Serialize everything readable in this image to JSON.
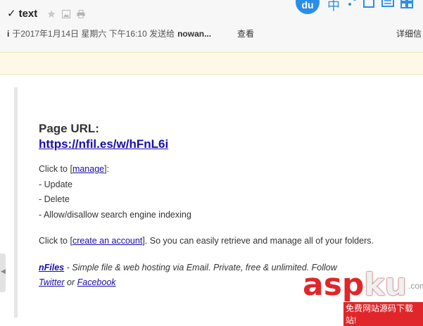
{
  "header": {
    "check_mark": "✓",
    "subject": "text",
    "meta_icon": "i",
    "meta_text": "于2017年1月14日 星期六 下午16:10 发送给",
    "recipient": "nowan...",
    "view_label": "查看",
    "details_label": "详细信"
  },
  "ime": {
    "logo": "du",
    "chinese": "中"
  },
  "email": {
    "page_url_label": "Page URL:",
    "page_url": "https://nfil.es/w/hFnL6i",
    "click_to": "Click to [",
    "manage_link": "manage",
    "manage_close": "]:",
    "items": [
      "- Update",
      "- Delete",
      "- Allow/disallow search engine indexing"
    ],
    "click_to2": "Click to [",
    "account_link": "create an account",
    "account_rest": "]. So you can easily retrieve and manage all of your folders.",
    "footer_brand": "nFiles",
    "footer_text": " - Simple file & web hosting via Email. Private, free & unlimited. Follow ",
    "twitter": "Twitter",
    "or": " or ",
    "facebook": "Facebook"
  },
  "watermark": {
    "asp": "asp",
    "ku": "ku",
    "com": ".com",
    "tagline": "免费网站源码下载站!"
  },
  "colors": {
    "link": "#1a0dab",
    "banner": "#fdf9e6",
    "ime_blue": "#2b8ee6",
    "watermark_red": "#e0262a"
  }
}
